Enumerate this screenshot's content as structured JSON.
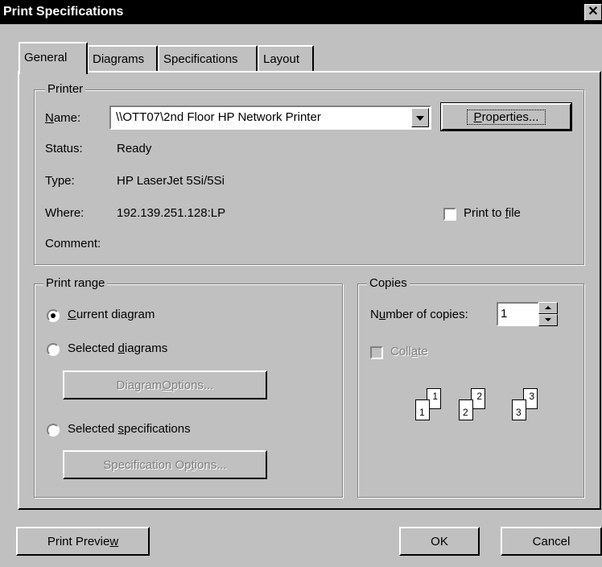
{
  "window": {
    "title": "Print Specifications",
    "close_glyph": "✕"
  },
  "tabs": [
    {
      "label": "General",
      "active": true
    },
    {
      "label": "Diagrams",
      "active": false
    },
    {
      "label": "Specifications",
      "active": false
    },
    {
      "label": "Layout",
      "active": false
    }
  ],
  "printer": {
    "legend": "Printer",
    "name_label_prefix": "",
    "name_label_mnemonic": "N",
    "name_label_rest": "ame:",
    "name_value": "\\\\OTT07\\2nd Floor HP Network Printer",
    "properties_mnemonic": "P",
    "properties_rest": "roperties...",
    "status_label": "Status:",
    "status_value": "Ready",
    "type_label": "Type:",
    "type_value": "HP LaserJet 5Si/5Si",
    "where_label": "Where:",
    "where_value": "192.139.251.128:LP",
    "comment_label": "Comment:",
    "comment_value": "",
    "print_to_file_prefix": "Print to ",
    "print_to_file_mnemonic": "f",
    "print_to_file_rest": "ile",
    "print_to_file_checked": false
  },
  "print_range": {
    "legend": "Print range",
    "current_mnemonic": "C",
    "current_rest": "urrent diagram",
    "current_checked": true,
    "selected_diagrams_prefix": "Selected ",
    "selected_diagrams_mnemonic": "d",
    "selected_diagrams_rest": "iagrams",
    "diagram_options_prefix": "Diagram ",
    "diagram_options_mnemonic": "O",
    "diagram_options_rest": "ptions...",
    "selected_specs_prefix": "Selected ",
    "selected_specs_mnemonic": "s",
    "selected_specs_rest": "pecifications",
    "spec_options_prefix": "Specification Op",
    "spec_options_mnemonic": "t",
    "spec_options_rest": "ions..."
  },
  "copies": {
    "legend": "Copies",
    "num_prefix": "N",
    "num_mnemonic": "u",
    "num_rest": "mber of copies:",
    "num_value": "1",
    "collate_prefix": "Coll",
    "collate_mnemonic": "a",
    "collate_rest": "te",
    "collate_checked": false,
    "illustration_pages": [
      "1",
      "1",
      "2",
      "2",
      "3",
      "3"
    ]
  },
  "footer": {
    "preview_prefix": "Print Previe",
    "preview_mnemonic": "w",
    "ok_label": "OK",
    "cancel_label": "Cancel"
  },
  "colors": {
    "face": "#c0c0c0",
    "shadow": "#808080",
    "highlight": "#ffffff",
    "title_bg": "#000000"
  }
}
